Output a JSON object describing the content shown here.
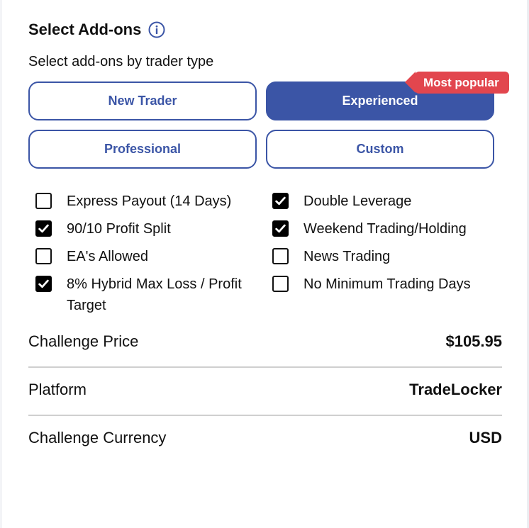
{
  "header": {
    "title": "Select Add-ons",
    "info_icon": "info-circle-icon"
  },
  "subtitle": "Select add-ons by trader type",
  "trader_types": [
    {
      "label": "New Trader",
      "active": false
    },
    {
      "label": "Experienced",
      "active": true
    },
    {
      "label": "Professional",
      "active": false
    },
    {
      "label": "Custom",
      "active": false
    }
  ],
  "badge": "Most popular",
  "addons": [
    {
      "label": "Express Payout (14 Days)",
      "checked": false
    },
    {
      "label": "90/10 Profit Split",
      "checked": true
    },
    {
      "label": "EA's Allowed",
      "checked": false
    },
    {
      "label": "8% Hybrid Max Loss / Profit Target",
      "checked": true
    },
    {
      "label": "Double Leverage",
      "checked": true
    },
    {
      "label": "Weekend Trading/Holding",
      "checked": true
    },
    {
      "label": "News Trading",
      "checked": false
    },
    {
      "label": "No Minimum Trading Days",
      "checked": false
    }
  ],
  "summary": [
    {
      "label": "Challenge Price",
      "value": "$105.95"
    },
    {
      "label": "Platform",
      "value": "TradeLocker"
    },
    {
      "label": "Challenge Currency",
      "value": "USD"
    }
  ],
  "colors": {
    "primary": "#3b55a6",
    "badge": "#e2464e",
    "divider": "#cfcfcf"
  }
}
